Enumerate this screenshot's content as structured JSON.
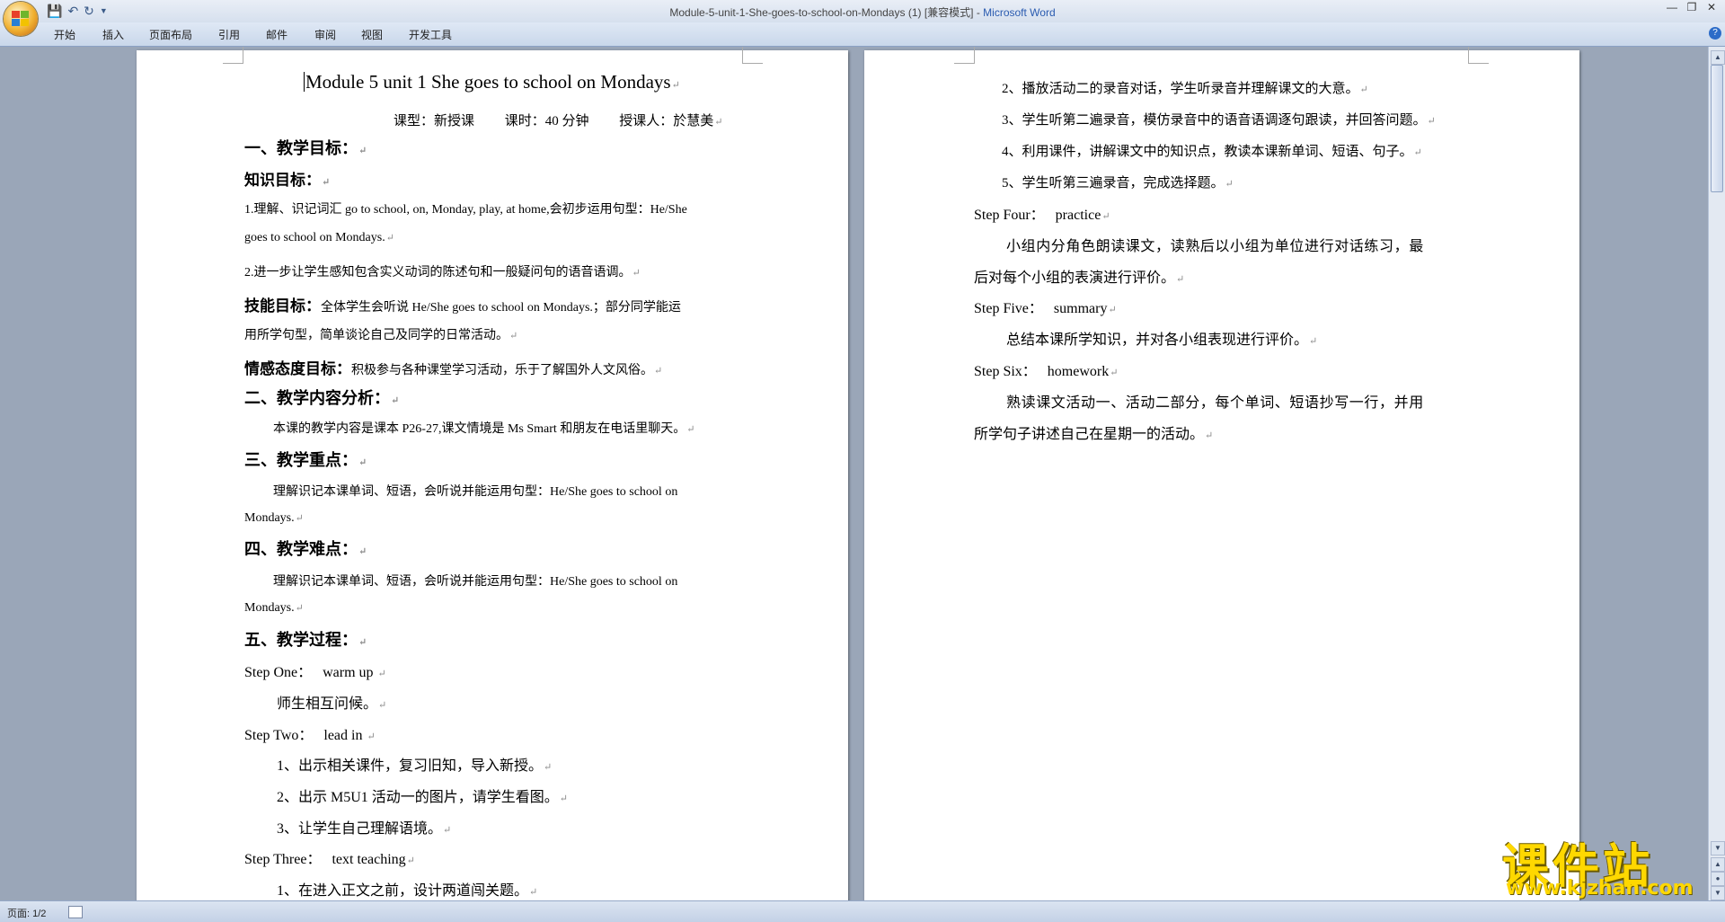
{
  "window": {
    "title": "Module-5-unit-1-She-goes-to-school-on-Mondays (1) [兼容模式] - ",
    "app_name": "Microsoft Word"
  },
  "ribbon": {
    "tabs": [
      "开始",
      "插入",
      "页面布局",
      "引用",
      "邮件",
      "审阅",
      "视图",
      "开发工具"
    ]
  },
  "status": {
    "page": "页面: 1/2"
  },
  "watermark": {
    "line1": "课件站",
    "line2": "www.kjzhan.com"
  },
  "page1": {
    "title": "Module 5 unit 1 She goes to school on Mondays",
    "meta": "课型：新授课         课时：40 分钟         授课人：於慧美",
    "sec1": "一、教学目标：",
    "knowledge_head": "知识目标：",
    "k1a": "1.理解、识记词汇  go to school, on, Monday, play, at home,会初步运用句型：He/She",
    "k1b": "goes to school on Mondays.",
    "k2": "2.进一步让学生感知包含实义动词的陈述句和一般疑问句的语音语调。",
    "skill_head": "技能目标：",
    "skill_a": "全体学生会听说 He/She goes to school on Mondays.；部分同学能运",
    "skill_b": "用所学句型，简单谈论自己及同学的日常活动。",
    "emotion_head": "情感态度目标：",
    "emotion_body": "积极参与各种课堂学习活动，乐于了解国外人文风俗。",
    "sec2": "二、教学内容分析：",
    "content": "本课的教学内容是课本 P26-27,课文情境是 Ms Smart  和朋友在电话里聊天。",
    "sec3": "三、教学重点：",
    "key_a": "理解识记本课单词、短语，会听说并能运用句型：He/She goes to school on",
    "key_b": "Mondays.",
    "sec4": "四、教学难点：",
    "diff_a": "理解识记本课单词、短语，会听说并能运用句型：He/She goes to school on",
    "diff_b": "Mondays.",
    "sec5": "五、教学过程：",
    "step1": "Step One：   warm up ",
    "step1_body": "师生相互问候。",
    "step2": "Step Two：   lead in ",
    "step2_1": "1、出示相关课件，复习旧知，导入新授。",
    "step2_2": "2、出示 M5U1 活动一的图片，请学生看图。",
    "step2_3": "3、让学生自己理解语境。",
    "step3": "Step Three：   text teaching",
    "step3_1": "1、在进入正文之前，设计两道闯关题。"
  },
  "page2": {
    "s3_2": "2、播放活动二的录音对话，学生听录音并理解课文的大意。",
    "s3_3": "3、学生听第二遍录音，模仿录音中的语音语调逐句跟读，并回答问题。",
    "s3_4": "4、利用课件，讲解课文中的知识点，教读本课新单词、短语、句子。",
    "s3_5": "5、学生听第三遍录音，完成选择题。",
    "step4": "Step Four：   practice",
    "step4_a": "小组内分角色朗读课文，读熟后以小组为单位进行对话练习，最",
    "step4_b": "后对每个小组的表演进行评价。",
    "step5": "Step Five：   summary",
    "step5_body": "总结本课所学知识，并对各小组表现进行评价。",
    "step6": "Step Six：   homework",
    "step6_a": "熟读课文活动一、活动二部分，每个单词、短语抄写一行，并用",
    "step6_b": "所学句子讲述自己在星期一的活动。"
  },
  "colors": {
    "ribbon_bg": "#dfe8f5",
    "workspace": "#9aa6b8",
    "app_name": "#2a5bb0",
    "watermark": "#ffd800"
  }
}
